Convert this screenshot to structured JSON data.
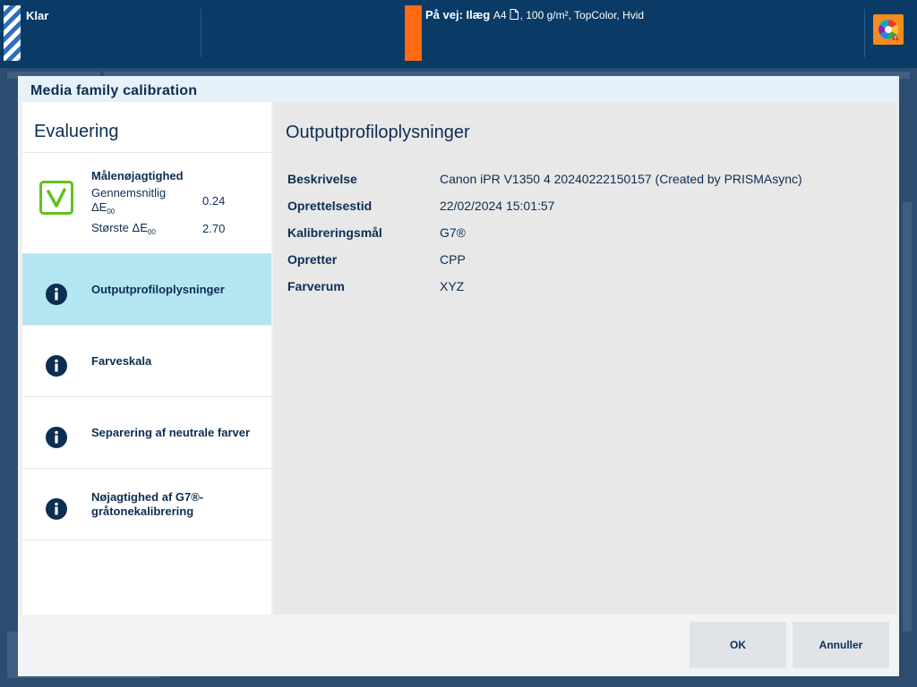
{
  "topbar": {
    "status": "Klar",
    "job_lead": "På vej: Ilæg",
    "job_size": "A4",
    "job_rest": ", 100 g/m², TopColor, Hvid",
    "status_color": "#ff6a13",
    "alert_icon": "color-wheel-warning-icon"
  },
  "dialog": {
    "title": "Media family calibration",
    "left_heading": "Evaluering",
    "evaluation": {
      "title": "Målenøjagtighed",
      "avg_label": "Gennemsnitlig",
      "delta_symbol": "ΔE",
      "delta_sub": "00",
      "avg_value": "0.24",
      "max_label": "Største ΔE",
      "max_value": "2.70"
    },
    "nav": [
      {
        "label": "Outputprofiloplysninger"
      },
      {
        "label": "Farveskala"
      },
      {
        "label": "Separering af neutrale farver"
      },
      {
        "label": "Nøjagtighed af G7®-gråtonekalibrering"
      }
    ],
    "right_heading": "Outputprofiloplysninger",
    "details": [
      {
        "label": "Beskrivelse",
        "value": "Canon iPR V1350 4 20240222150157 (Created by PRISMAsync)"
      },
      {
        "label": "Oprettelsestid",
        "value": "22/02/2024 15:01:57"
      },
      {
        "label": "Kalibreringsmål",
        "value": "G7®"
      },
      {
        "label": "Opretter",
        "value": "CPP"
      },
      {
        "label": "Farverum",
        "value": "XYZ"
      }
    ],
    "ok_label": "OK",
    "cancel_label": "Annuller"
  }
}
